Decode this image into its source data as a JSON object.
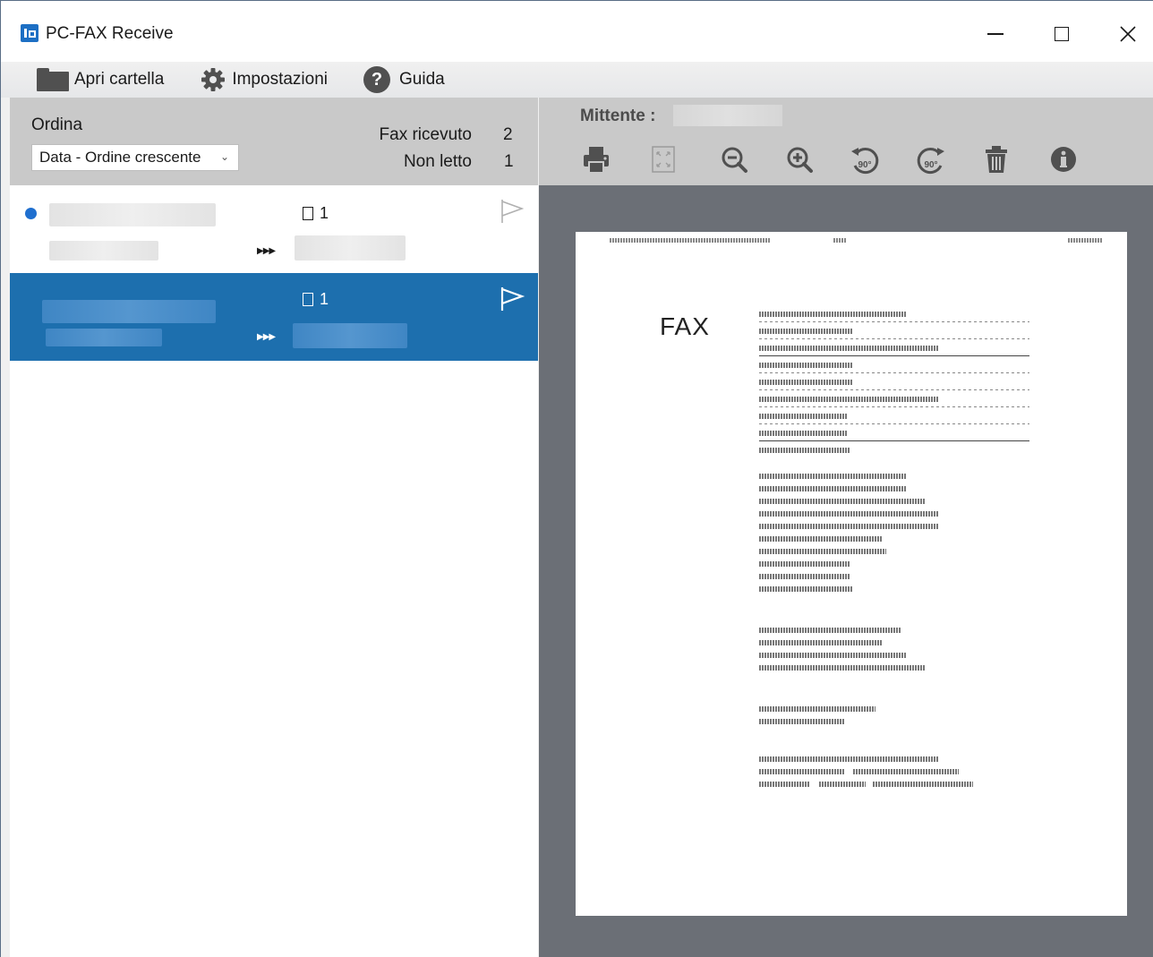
{
  "window": {
    "title": "PC-FAX Receive"
  },
  "menu": {
    "open_folder": "Apri cartella",
    "settings": "Impostazioni",
    "help": "Guida"
  },
  "sort": {
    "label": "Ordina",
    "selected": "Data - Ordine crescente",
    "received_label": "Fax ricevuto",
    "received_count": "2",
    "unread_label": "Non letto",
    "unread_count": "1"
  },
  "fax_items": [
    {
      "page_count": "1",
      "unread": true,
      "selected": false,
      "flagged": false
    },
    {
      "page_count": "1",
      "unread": false,
      "selected": true,
      "flagged": true
    }
  ],
  "viewer": {
    "sender_label": "Mittente :",
    "document_heading": "FAX",
    "toolbar": [
      "print-icon",
      "fit-page-icon",
      "zoom-out-icon",
      "zoom-in-icon",
      "rotate-left-icon",
      "rotate-right-icon",
      "delete-icon",
      "info-icon"
    ],
    "rotate_left_label": "90°",
    "rotate_right_label": "90°"
  },
  "colors": {
    "accent": "#1d6fae",
    "unread_dot": "#1f6fcf",
    "viewer_bg": "#6b6f76",
    "header_bg": "#c9c9c9",
    "icon_gray": "#505050"
  }
}
